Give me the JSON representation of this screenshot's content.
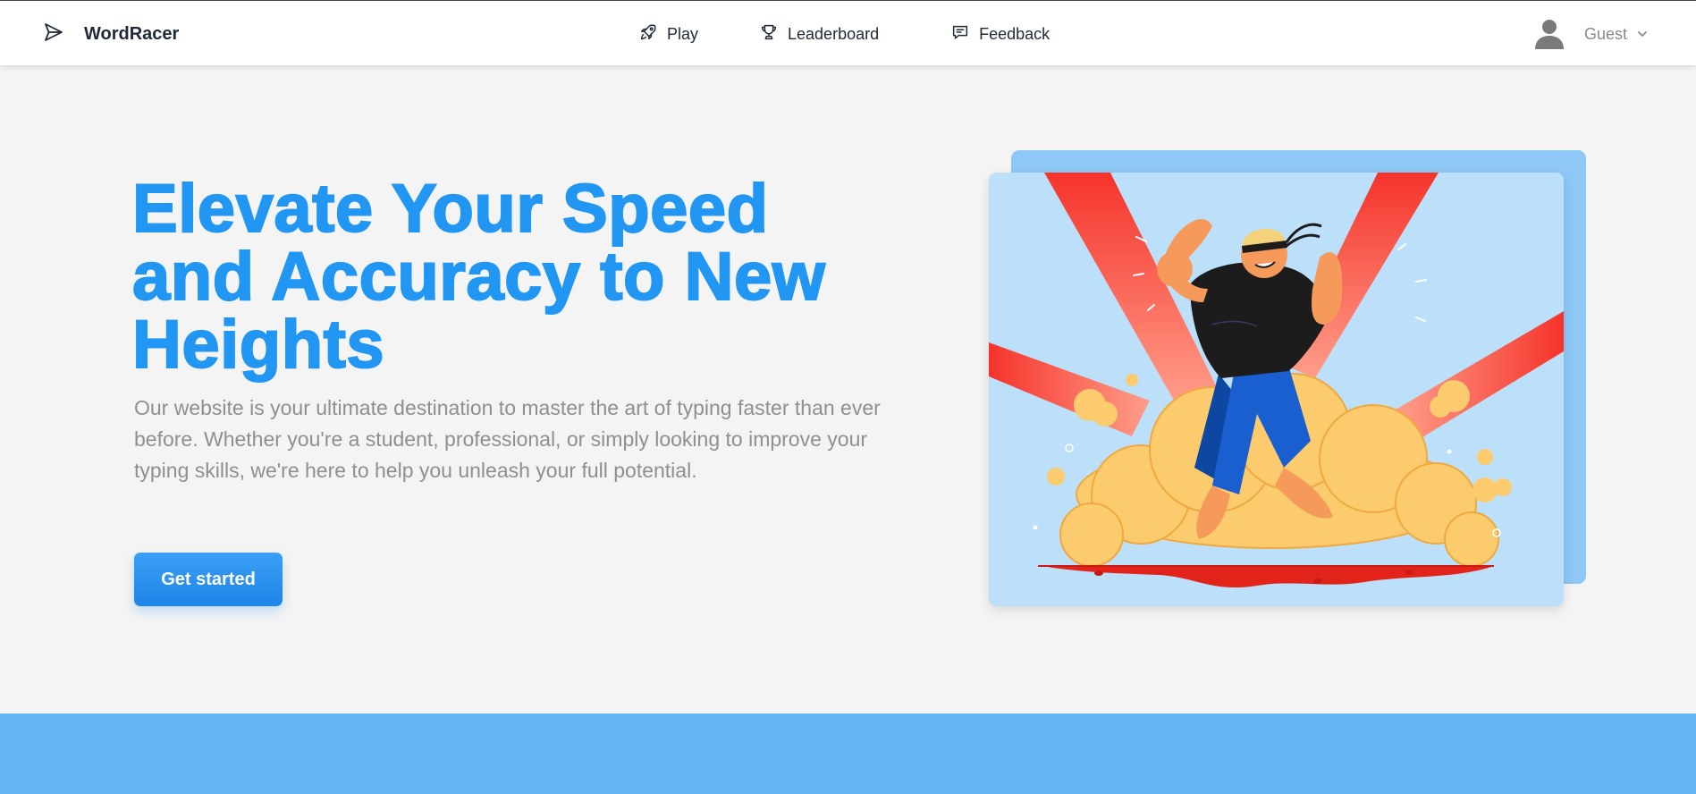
{
  "brand": {
    "name": "WordRacer",
    "icon": "paper-plane-icon"
  },
  "nav": {
    "play": {
      "label": "Play",
      "icon": "rocket-icon"
    },
    "leaderboard": {
      "label": "Leaderboard",
      "icon": "trophy-icon"
    },
    "feedback": {
      "label": "Feedback",
      "icon": "chat-icon"
    }
  },
  "user": {
    "name": "Guest",
    "icon": "user-avatar-icon",
    "menu_icon": "chevron-down-icon"
  },
  "hero": {
    "title": "Elevate Your Speed and Accuracy to New Heights",
    "description": "Our website is your ultimate destination to master the art of typing faster than ever before. Whether you're a student, professional, or simply looking to improve your typing skills, we're here to help you unleash your full potential.",
    "cta_label": "Get started"
  },
  "colors": {
    "accent": "#2196f3",
    "footer_band": "#64b5f6",
    "background": "#f4f4f4"
  }
}
